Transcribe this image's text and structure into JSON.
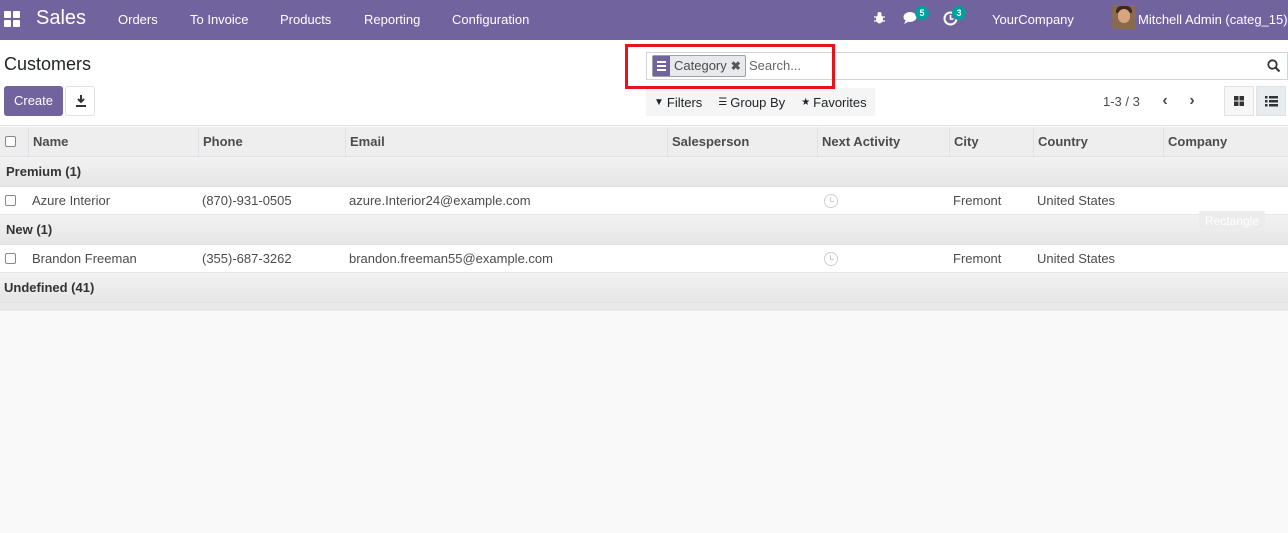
{
  "navbar": {
    "app_name": "Sales",
    "menu": [
      "Orders",
      "To Invoice",
      "Products",
      "Reporting",
      "Configuration"
    ],
    "messages_count": "5",
    "activities_count": "3",
    "company": "YourCompany",
    "user": "Mitchell Admin (categ_15)",
    "icons": {
      "apps": "apps-grid-icon",
      "debug": "bug-icon",
      "messages": "chat-icon",
      "activities": "clock-icon"
    }
  },
  "control_panel": {
    "title": "Customers",
    "create_label": "Create",
    "download_icon": "download-icon",
    "search": {
      "facet_label": "Category",
      "placeholder": "Search..."
    },
    "filters_label": "Filters",
    "group_by_label": "Group By",
    "favorites_label": "Favorites",
    "pager_value": "1-3 / 3"
  },
  "table": {
    "columns": [
      "Name",
      "Phone",
      "Email",
      "Salesperson",
      "Next Activity",
      "City",
      "Country",
      "Company"
    ],
    "groups": [
      {
        "label": "Premium (1)",
        "rows": [
          {
            "name": "Azure Interior",
            "phone": "(870)-931-0505",
            "email": "azure.Interior24@example.com",
            "salesperson": "",
            "city": "Fremont",
            "country": "United States",
            "company": ""
          }
        ]
      },
      {
        "label": "New (1)",
        "rows": [
          {
            "name": "Brandon Freeman",
            "phone": "(355)-687-3262",
            "email": "brandon.freeman55@example.com",
            "salesperson": "",
            "city": "Fremont",
            "country": "United States",
            "company": ""
          }
        ]
      },
      {
        "label": "Undefined (41)",
        "rows": []
      }
    ]
  },
  "overlay": {
    "tooltip": "Rectangle"
  },
  "colors": {
    "brand": "#71639e",
    "highlight": "#e8121d",
    "badge": "#00a09d"
  }
}
